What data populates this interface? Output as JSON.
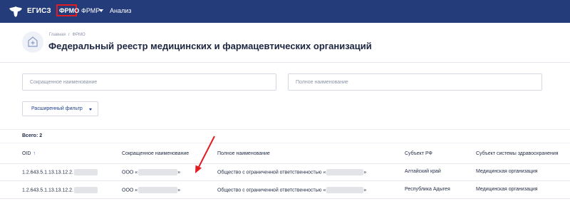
{
  "nav": {
    "brand": "ЕГИСЗ",
    "items": [
      {
        "label": "ФРМО"
      },
      {
        "label": "ФРМР"
      },
      {
        "label": "Анализ"
      }
    ]
  },
  "header": {
    "breadcrumbs": [
      "Главная",
      "ФРМО"
    ],
    "breadcrumb_separator": "/",
    "title": "Федеральный реестр медицинских и фармацевтических организаций"
  },
  "filters": {
    "short_name_placeholder": "Сокращенное наименование",
    "full_name_placeholder": "Полное наименование",
    "extended_filter_label": "Расширенный фильтр"
  },
  "summary": {
    "count_label": "Всего: 2"
  },
  "table": {
    "columns": [
      "OID",
      "Сокращенное наименование",
      "Полное наименование",
      "Субъект РФ",
      "Субъект системы здравоохранения"
    ],
    "sort_indicator": "↑",
    "rows": [
      {
        "oid": "1.2.643.5.1.13.13.12.2.",
        "short_name_prefix": "ООО «",
        "short_name_suffix": "»",
        "full_name_prefix": "Общество с ограниченной ответственностью «",
        "full_name_suffix": "»",
        "region": "Алтайский край",
        "health_system_subject": "Медицинская организация"
      },
      {
        "oid": "1.2.643.5.1.13.13.12.2.",
        "short_name_prefix": "ООО «",
        "short_name_suffix": "»",
        "full_name_prefix": "Общество с ограниченной ответственностью «",
        "full_name_suffix": "»",
        "region": "Республика Адыгея",
        "health_system_subject": "Медицинская организация"
      }
    ]
  },
  "colors": {
    "navbar": "#253c7a",
    "highlight_box": "#e31c23",
    "annotation_arrow": "#e31c23",
    "accent": "#2a62c9"
  }
}
